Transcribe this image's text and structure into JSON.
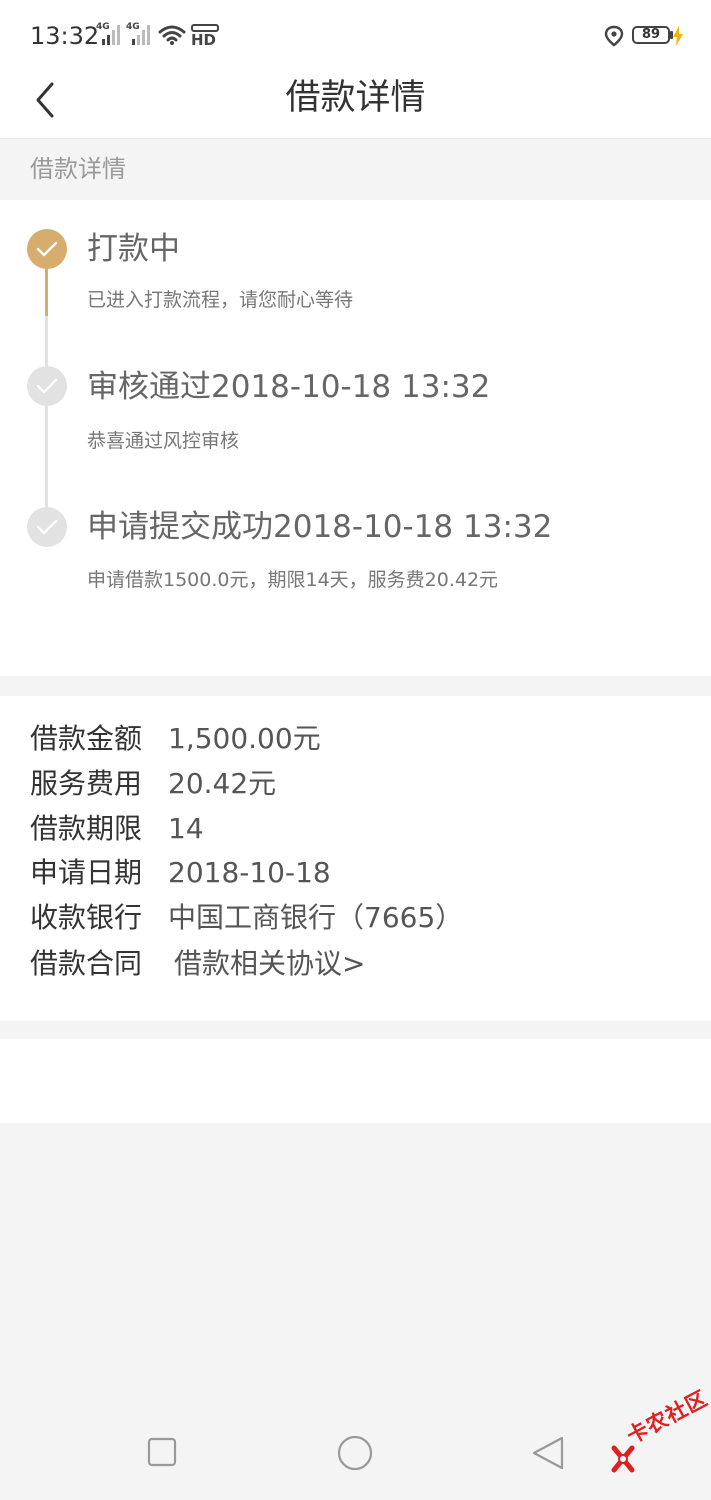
{
  "status_bar": {
    "time": "13:32",
    "signal_1_label": "4G",
    "signal_2_label": "4G",
    "hd_label": "HD",
    "battery": "89"
  },
  "header": {
    "title": "借款详情"
  },
  "section": {
    "label": "借款详情"
  },
  "timeline": {
    "steps": [
      {
        "title": "打款中",
        "subtitle": "已进入打款流程，请您耐心等待"
      },
      {
        "title": "审核通过2018-10-18 13:32",
        "subtitle": "恭喜通过风控审核"
      },
      {
        "title": "申请提交成功2018-10-18 13:32",
        "subtitle": "申请借款1500.0元，期限14天，服务费20.42元"
      }
    ]
  },
  "details": {
    "rows": [
      {
        "label": "借款金额",
        "value": "1,500.00元"
      },
      {
        "label": "服务费用",
        "value": "20.42元"
      },
      {
        "label": "借款期限",
        "value": "14"
      },
      {
        "label": "申请日期",
        "value": "2018-10-18"
      },
      {
        "label": "收款银行",
        "value": "中国工商银行（7665）"
      },
      {
        "label": "借款合同",
        "value": "借款相关协议>"
      }
    ]
  },
  "watermark": {
    "text": "卡农社区"
  },
  "colors": {
    "accent": "#d6ad6d",
    "inactive": "#e2e2e2",
    "background": "#f4f4f4"
  },
  "icons": {
    "back": "chevron-left-icon",
    "check": "check-icon",
    "wifi": "wifi-icon",
    "location": "location-icon",
    "battery": "battery-icon"
  }
}
